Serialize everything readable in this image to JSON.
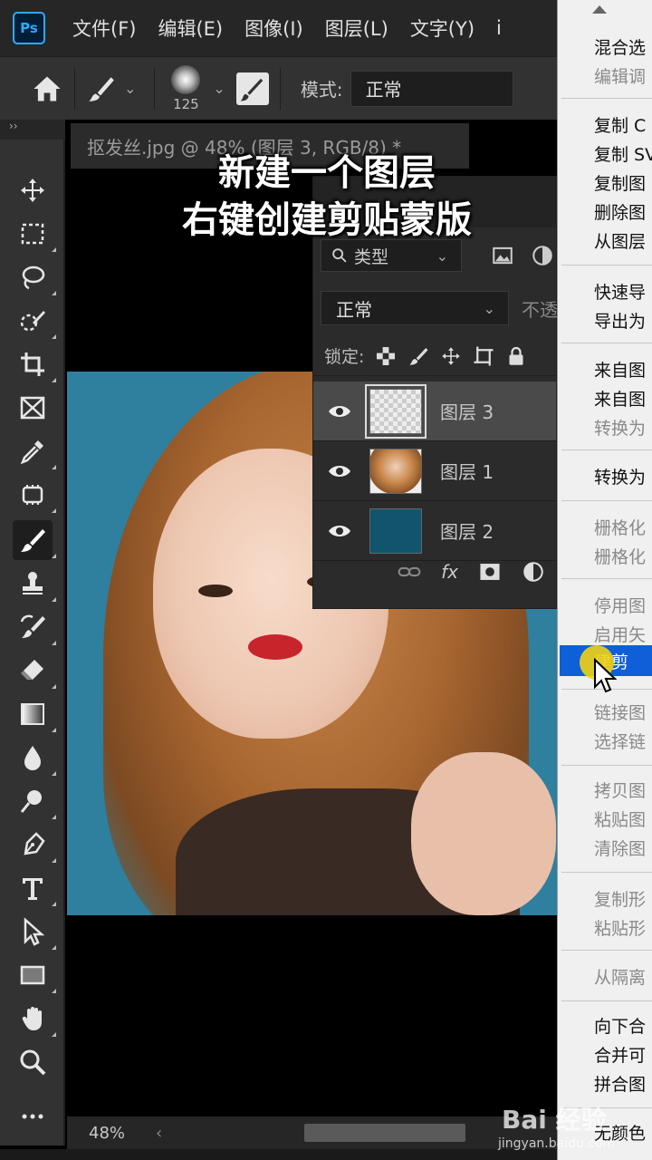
{
  "menubar": {
    "logo": "Ps",
    "items": [
      "文件(F)",
      "编辑(E)",
      "图像(I)",
      "图层(L)",
      "文字(Y)",
      "i"
    ]
  },
  "options_bar": {
    "brush_size": "125",
    "mode_label": "模式:",
    "mode_value": "正常"
  },
  "toolbar": {
    "collapse": "››",
    "tools": [
      "move",
      "marquee",
      "lasso",
      "quick-select",
      "crop",
      "frame",
      "eyedropper",
      "patch",
      "brush",
      "stamp",
      "history-brush",
      "eraser",
      "gradient",
      "blur",
      "dodge",
      "pen",
      "type",
      "path-select",
      "rectangle",
      "hand",
      "zoom",
      "more"
    ],
    "active_tool": "brush"
  },
  "document": {
    "tab_title": "抠发丝.jpg @ 48% (图层 3, RGB/8) *"
  },
  "caption": {
    "line1": "新建一个图层",
    "line2": "右键创建剪贴蒙版"
  },
  "layers_panel": {
    "filter_label": "类型",
    "blend_mode": "正常",
    "opacity_label": "不透",
    "lock_label": "锁定:",
    "layers": [
      {
        "name": "图层 3",
        "thumb": "transparent",
        "selected": true
      },
      {
        "name": "图层 1",
        "thumb": "photo",
        "selected": false
      },
      {
        "name": "图层 2",
        "thumb": "fill",
        "selected": false
      }
    ],
    "fx_label": "fx"
  },
  "status_bar": {
    "zoom": "48%",
    "scroll_left": "‹"
  },
  "context_menu": {
    "items": [
      {
        "label": "混合选",
        "enabled": true
      },
      {
        "label": "编辑调",
        "enabled": false
      },
      {
        "label": "复制 C",
        "enabled": true
      },
      {
        "label": "复制 SV",
        "enabled": true
      },
      {
        "label": "复制图",
        "enabled": true
      },
      {
        "label": "删除图",
        "enabled": true
      },
      {
        "label": "从图层",
        "enabled": true
      },
      {
        "label": "快速导",
        "enabled": true
      },
      {
        "label": "导出为",
        "enabled": true
      },
      {
        "label": "来自图",
        "enabled": true
      },
      {
        "label": "来自图",
        "enabled": true
      },
      {
        "label": "转换为",
        "enabled": false
      },
      {
        "label": "转换为",
        "enabled": true
      },
      {
        "label": "栅格化",
        "enabled": false
      },
      {
        "label": "栅格化",
        "enabled": false
      },
      {
        "label": "停用图",
        "enabled": false
      },
      {
        "label": "启用矢",
        "enabled": false
      },
      {
        "label": "链接图",
        "enabled": false
      },
      {
        "label": "选择链",
        "enabled": false
      },
      {
        "label": "拷贝图",
        "enabled": false
      },
      {
        "label": "粘贴图",
        "enabled": false
      },
      {
        "label": "清除图",
        "enabled": false
      },
      {
        "label": "复制形",
        "enabled": false
      },
      {
        "label": "粘贴形",
        "enabled": false
      },
      {
        "label": "从隔离",
        "enabled": false
      },
      {
        "label": "向下合",
        "enabled": true
      },
      {
        "label": "合并可",
        "enabled": true
      },
      {
        "label": "拼合图",
        "enabled": true
      },
      {
        "label": "无颜色",
        "enabled": true
      }
    ],
    "highlighted": "建剪"
  },
  "watermark": {
    "logo": "Bai 经验",
    "url": "jingyan.baidu.com"
  },
  "colors": {
    "ps_blue": "#31a8ff",
    "canvas_bg": "#2f7f9f",
    "menu_highlight": "#0e5fd8",
    "layer2_fill": "#12546e"
  }
}
